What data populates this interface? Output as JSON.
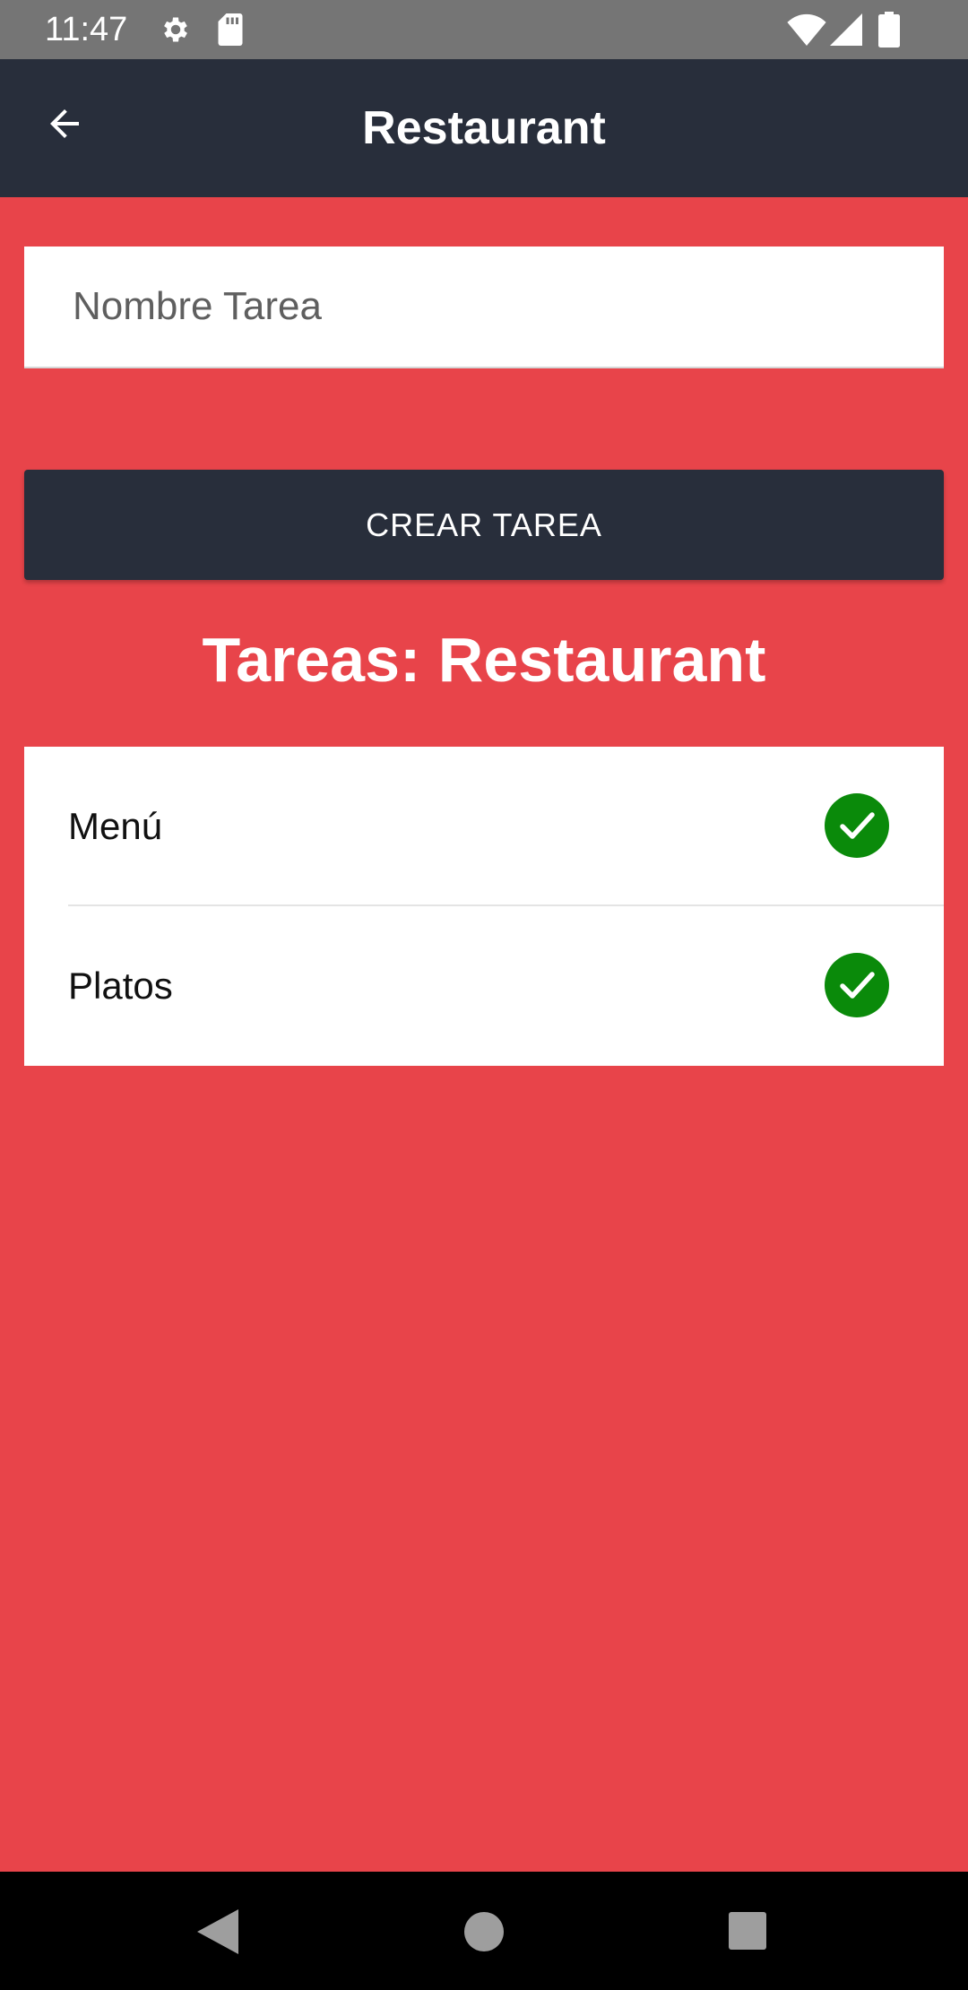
{
  "status_bar": {
    "time": "11:47",
    "icons": [
      "gear-icon",
      "sd-card-icon",
      "wifi-icon",
      "signal-icon",
      "battery-icon"
    ]
  },
  "app_bar": {
    "title": "Restaurant",
    "back_icon": "arrow-left-icon"
  },
  "form": {
    "input_placeholder": "Nombre Tarea",
    "input_value": "",
    "create_button_label": "CREAR TAREA"
  },
  "heading": "Tareas: Restaurant",
  "tasks": [
    {
      "label": "Menú",
      "icon": "check-circle-icon",
      "completed": true
    },
    {
      "label": "Platos",
      "icon": "check-circle-icon",
      "completed": true
    }
  ],
  "nav_bar": {
    "icons": [
      "nav-back-icon",
      "nav-home-icon",
      "nav-recents-icon"
    ]
  },
  "colors": {
    "background": "#e8444a",
    "app_bar": "#282e3b",
    "status_bar": "#757575",
    "check": "#0a8a0a"
  }
}
